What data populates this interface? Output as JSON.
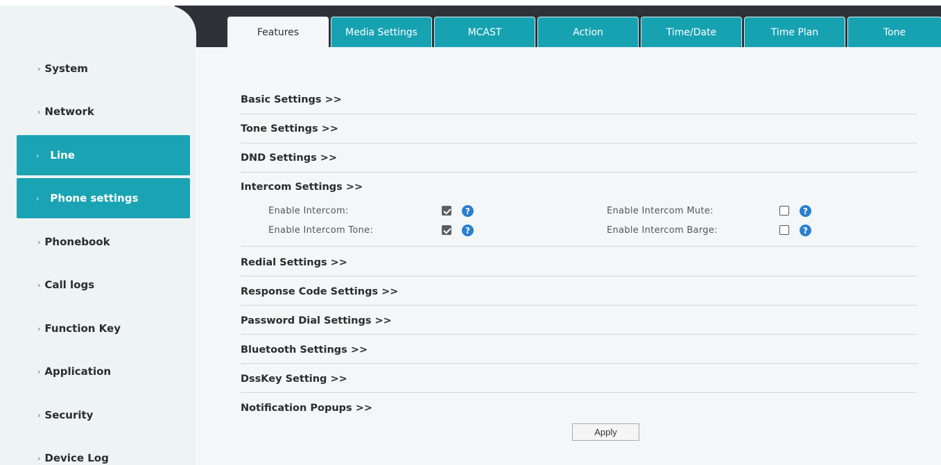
{
  "sidebar": {
    "items": [
      {
        "label": "System",
        "active": false
      },
      {
        "label": "Network",
        "active": false
      },
      {
        "label": "Line",
        "active": true
      },
      {
        "label": "Phone settings",
        "active": true
      },
      {
        "label": "Phonebook",
        "active": false
      },
      {
        "label": "Call logs",
        "active": false
      },
      {
        "label": "Function Key",
        "active": false
      },
      {
        "label": "Application",
        "active": false
      },
      {
        "label": "Security",
        "active": false
      },
      {
        "label": "Device Log",
        "active": false
      }
    ],
    "chevron": "›"
  },
  "tabs": [
    {
      "label": "Features",
      "active": true
    },
    {
      "label": "Media Settings",
      "active": false
    },
    {
      "label": "MCAST",
      "active": false
    },
    {
      "label": "Action",
      "active": false
    },
    {
      "label": "Time/Date",
      "active": false
    },
    {
      "label": "Time Plan",
      "active": false
    },
    {
      "label": "Tone",
      "active": false
    }
  ],
  "sections": {
    "basic": "Basic Settings >>",
    "tone": "Tone Settings >>",
    "dnd": "DND Settings >>",
    "intercom": "Intercom Settings >>",
    "redial": "Redial Settings >>",
    "response_code": "Response Code Settings >>",
    "password_dial": "Password Dial Settings >>",
    "bluetooth": "Bluetooth Settings >>",
    "dsskey": "DssKey Setting >>",
    "notification": "Notification Popups >>"
  },
  "intercom": {
    "enable_intercom": {
      "label": "Enable Intercom:",
      "checked": true
    },
    "enable_intercom_tone": {
      "label": "Enable Intercom Tone:",
      "checked": true
    },
    "enable_intercom_mute": {
      "label": "Enable Intercom Mute:",
      "checked": false
    },
    "enable_intercom_barge": {
      "label": "Enable Intercom Barge:",
      "checked": false
    },
    "help_glyph": "?"
  },
  "apply_label": "Apply",
  "colors": {
    "accent": "#1aa3b3",
    "header": "#2e3138",
    "help_icon": "#2a7fcf"
  }
}
